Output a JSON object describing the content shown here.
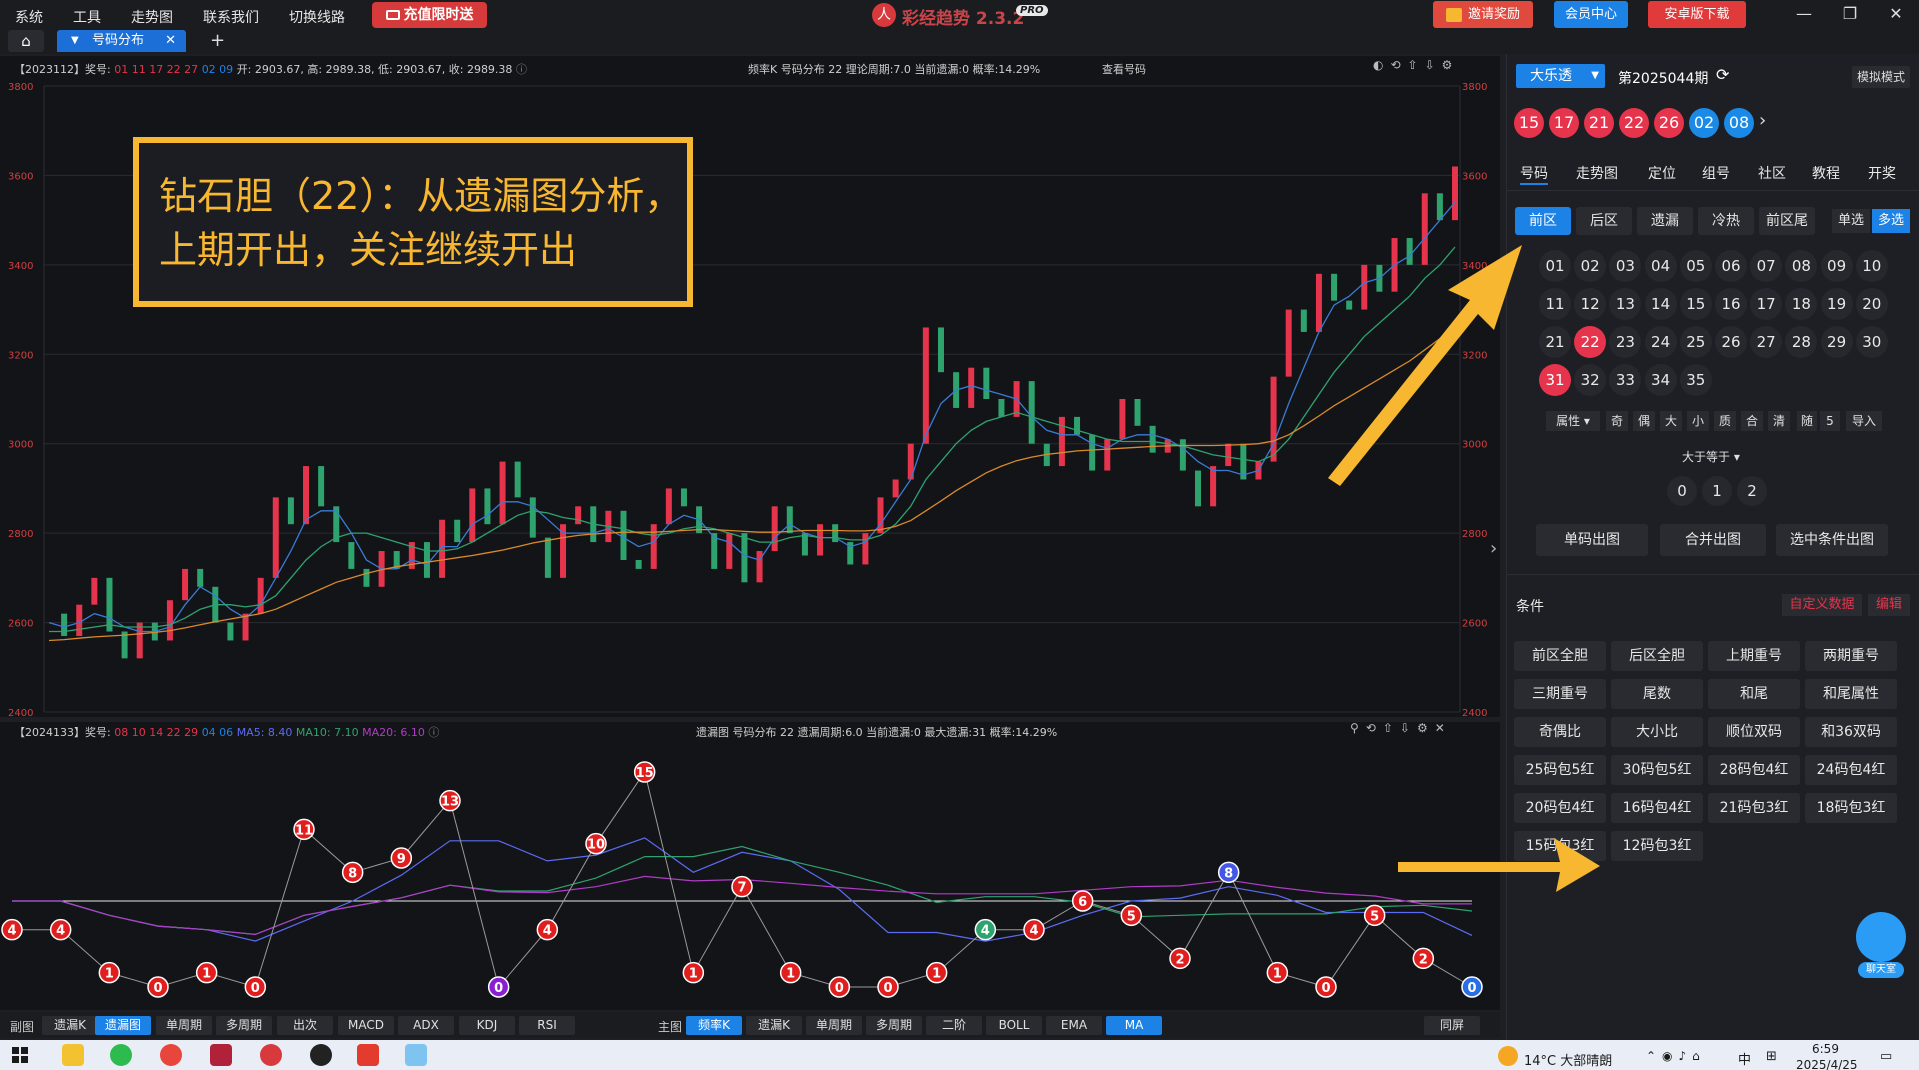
{
  "menu": [
    "系统",
    "工具",
    "走势图",
    "联系我们",
    "切换线路"
  ],
  "promo_label": "充值限时送",
  "app": {
    "title": "彩经趋势 2.3.2",
    "badge": "PRO",
    "logo": "人"
  },
  "top_buttons": {
    "invite": "邀请奖励",
    "member": "会员中心",
    "android": "安卓版下载"
  },
  "tabs": {
    "active": "号码分布",
    "close": "✕",
    "add": "+"
  },
  "upper_chart": {
    "header_left": "【2023112】奖号:",
    "draw_numbers": "01 11 17 22 27",
    "draw_back": "02 09",
    "ohlc": "开: 2903.67, 高: 2989.38, 低: 2903.67, 收: 2989.38",
    "header_mid": "频率K   号码分布  22    理论周期:7.0   当前遗漏:0   概率:14.29%",
    "view_link": "查看号码",
    "y_ticks": [
      "3800",
      "3600",
      "3400",
      "3200",
      "3000",
      "2800",
      "2600",
      "2400"
    ]
  },
  "lower_chart": {
    "header_left": "【2024133】奖号:",
    "draw_numbers": "08 10 14 22 29",
    "draw_back": "04 06",
    "ma_text": "MA5: 8.40",
    "ma10_text": "MA10: 7.10",
    "ma20_text": "MA20: 6.10",
    "header_mid": "遗漏图   号码分布  22     遗漏周期:6.0   当前遗漏:0   最大遗漏:31   概率:14.29%"
  },
  "annotation": {
    "line1": "钻石胆（22）：从遗漏图分析，",
    "line2": "上期开出，关注继续开出"
  },
  "chart_data": [
    {
      "type": "line",
      "title": "频率K 号码分布 22",
      "ylim": [
        2400,
        3800
      ],
      "y_ticks": [
        2400,
        2600,
        2800,
        3000,
        3200,
        3400,
        3600,
        3800
      ],
      "series": [
        {
          "name": "频率K",
          "values": [
            2620,
            2570,
            2640,
            2700,
            2580,
            2520,
            2600,
            2560,
            2650,
            2720,
            2680,
            2600,
            2560,
            2620,
            2700,
            2880,
            2820,
            2950,
            2860,
            2780,
            2720,
            2680,
            2760,
            2720,
            2780,
            2700,
            2830,
            2780,
            2900,
            2820,
            2960,
            2880,
            2790,
            2700,
            2820,
            2860,
            2780,
            2850,
            2740,
            2720,
            2820,
            2900,
            2860,
            2800,
            2720,
            2800,
            2690,
            2760,
            2860,
            2800,
            2750,
            2820,
            2780,
            2730,
            2800,
            2880,
            2920,
            3000,
            3260,
            3160,
            3080,
            3170,
            3100,
            3060,
            3140,
            3000,
            2950,
            3060,
            3020,
            2940,
            3010,
            3100,
            3040,
            2980,
            3010,
            2940,
            2860,
            2950,
            3000,
            2920,
            2960,
            3150,
            3300,
            3250,
            3380,
            3320,
            3300,
            3400,
            3340,
            3460,
            3400,
            3560,
            3500,
            3620
          ]
        },
        {
          "name": "MA5",
          "values": [
            2600,
            2590,
            2600,
            2620,
            2610,
            2590,
            2580,
            2580,
            2590,
            2640,
            2680,
            2660,
            2630,
            2610,
            2640,
            2700,
            2760,
            2830,
            2850,
            2850,
            2800,
            2740,
            2720,
            2720,
            2740,
            2730,
            2770,
            2770,
            2820,
            2840,
            2870,
            2870,
            2860,
            2830,
            2800,
            2800,
            2800,
            2810,
            2790,
            2770,
            2780,
            2820,
            2840,
            2830,
            2790,
            2780,
            2750,
            2740,
            2790,
            2820,
            2800,
            2790,
            2790,
            2770,
            2780,
            2820,
            2870,
            2920,
            3020,
            3090,
            3120,
            3130,
            3120,
            3110,
            3100,
            3060,
            3030,
            3020,
            3020,
            3000,
            2990,
            3010,
            3020,
            3020,
            3010,
            2990,
            2960,
            2940,
            2940,
            2930,
            2940,
            3000,
            3090,
            3170,
            3250,
            3310,
            3330,
            3360,
            3370,
            3400,
            3420,
            3460,
            3500,
            3540
          ]
        },
        {
          "name": "MA10",
          "values": [
            2580,
            2580,
            2585,
            2590,
            2595,
            2590,
            2590,
            2590,
            2595,
            2610,
            2630,
            2640,
            2640,
            2635,
            2640,
            2660,
            2700,
            2740,
            2770,
            2790,
            2800,
            2800,
            2790,
            2780,
            2770,
            2760,
            2760,
            2765,
            2780,
            2800,
            2820,
            2840,
            2850,
            2845,
            2835,
            2830,
            2820,
            2815,
            2810,
            2800,
            2795,
            2800,
            2810,
            2815,
            2810,
            2800,
            2790,
            2780,
            2780,
            2790,
            2795,
            2790,
            2790,
            2785,
            2785,
            2795,
            2820,
            2860,
            2920,
            2960,
            3000,
            3030,
            3050,
            3060,
            3070,
            3060,
            3050,
            3040,
            3030,
            3020,
            3010,
            3005,
            3005,
            3005,
            3000,
            2995,
            2985,
            2975,
            2970,
            2965,
            2960,
            2975,
            3010,
            3060,
            3110,
            3160,
            3200,
            3240,
            3270,
            3300,
            3330,
            3370,
            3400,
            3440
          ]
        },
        {
          "name": "MA20",
          "values": [
            2560,
            2562,
            2565,
            2568,
            2570,
            2572,
            2575,
            2578,
            2582,
            2588,
            2595,
            2602,
            2608,
            2614,
            2620,
            2630,
            2645,
            2660,
            2675,
            2690,
            2700,
            2710,
            2718,
            2725,
            2730,
            2735,
            2740,
            2745,
            2750,
            2756,
            2762,
            2770,
            2778,
            2784,
            2790,
            2795,
            2798,
            2800,
            2802,
            2802,
            2802,
            2804,
            2806,
            2808,
            2808,
            2806,
            2804,
            2802,
            2802,
            2804,
            2806,
            2806,
            2806,
            2805,
            2805,
            2808,
            2815,
            2828,
            2850,
            2872,
            2895,
            2915,
            2935,
            2950,
            2962,
            2970,
            2976,
            2980,
            2984,
            2986,
            2988,
            2990,
            2992,
            2994,
            2995,
            2996,
            2996,
            2996,
            2997,
            2998,
            3000,
            3006,
            3020,
            3040,
            3062,
            3085,
            3105,
            3125,
            3145,
            3165,
            3185,
            3210,
            3235,
            3260
          ]
        }
      ]
    },
    {
      "type": "line",
      "title": "遗漏图 号码分布 22",
      "x": [
        1,
        2,
        3,
        4,
        5,
        6,
        7,
        8,
        9,
        10,
        11,
        12,
        13,
        14,
        15,
        16,
        17,
        18,
        19,
        20,
        21,
        22,
        23,
        24,
        25,
        26,
        27,
        28,
        29,
        30,
        31
      ],
      "series": [
        {
          "name": "遗漏",
          "values": [
            4,
            4,
            1,
            0,
            1,
            0,
            11,
            8,
            9,
            13,
            0,
            4,
            10,
            15,
            1,
            7,
            1,
            0,
            0,
            1,
            4,
            4,
            6,
            5,
            2,
            8,
            1,
            0,
            5,
            2,
            0
          ]
        }
      ],
      "reference_line": 6
    }
  ],
  "bottom_toolbar": {
    "left_label": "副图",
    "left_buttons": [
      "遗漏K",
      "遗漏图",
      "单周期",
      "多周期",
      "出次",
      "MACD",
      "ADX",
      "KDJ",
      "RSI"
    ],
    "left_active": 1,
    "main_label": "主图",
    "main_buttons": [
      "频率K",
      "遗漏K",
      "单周期",
      "多周期",
      "二阶",
      "BOLL",
      "EMA",
      "MA"
    ],
    "main_active": [
      0,
      7
    ],
    "right_button": "同屏"
  },
  "right_panel": {
    "lottery_select": "大乐透",
    "period": "第2025044期",
    "sim_mode": "模拟模式",
    "balls_front": [
      "15",
      "17",
      "21",
      "22",
      "26"
    ],
    "balls_back": [
      "02",
      "08"
    ],
    "nav_tabs": [
      "号码",
      "走势图",
      "定位",
      "组号",
      "社区",
      "教程",
      "开奖"
    ],
    "sub_tabs": [
      "前区",
      "后区",
      "遗漏",
      "冷热",
      "前区尾"
    ],
    "single_select": "单选",
    "multi_select": "多选",
    "numbers": [
      "01",
      "02",
      "03",
      "04",
      "05",
      "06",
      "07",
      "08",
      "09",
      "10",
      "11",
      "12",
      "13",
      "14",
      "15",
      "16",
      "17",
      "18",
      "19",
      "20",
      "21",
      "22",
      "23",
      "24",
      "25",
      "26",
      "27",
      "28",
      "29",
      "30",
      "31",
      "32",
      "33",
      "34",
      "35"
    ],
    "selected_numbers": [
      "22",
      "31"
    ],
    "attr_select": "属性",
    "attr_buttons": [
      "奇",
      "偶",
      "大",
      "小",
      "质",
      "合",
      "清"
    ],
    "random_label": "随",
    "random_count": "5",
    "import_label": "导入",
    "compare_select": "大于等于",
    "count_options": [
      "0",
      "1",
      "2"
    ],
    "action_buttons": [
      "单码出图",
      "合并出图",
      "选中条件出图"
    ],
    "condition_label": "条件",
    "custom_data": "自定义数据",
    "edit": "编辑",
    "conditions": [
      "前区全胆",
      "后区全胆",
      "上期重号",
      "两期重号",
      "三期重号",
      "尾数",
      "和尾",
      "和尾属性",
      "奇偶比",
      "大小比",
      "顺位双码",
      "和36双码",
      "25码包5红",
      "30码包5红",
      "28码包4红",
      "24码包4红",
      "20码包4红",
      "16码包4红",
      "21码包3红",
      "18码包3红",
      "15码包3红",
      "12码包3红"
    ],
    "chat_label": "聊天室"
  },
  "taskbar": {
    "weather": "14°C 大部晴朗",
    "time": "6:59",
    "date": "2025/4/25",
    "ime": "中"
  }
}
